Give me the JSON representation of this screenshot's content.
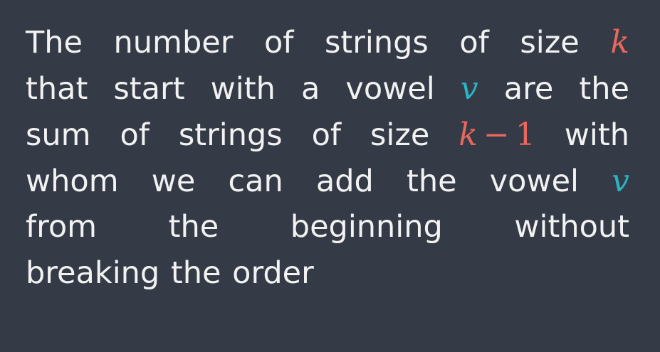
{
  "lines": [
    [
      "The",
      "number",
      "of",
      "strings",
      "of",
      "size"
    ],
    [
      "that",
      "start",
      "with",
      "a",
      "vowel"
    ],
    [
      "sum",
      "of",
      "strings",
      "of",
      "size"
    ],
    [
      "whom",
      "we",
      "can",
      "add",
      "the",
      "vowel"
    ],
    [
      "from",
      "the",
      "beginning",
      "without"
    ],
    [
      "breaking the order"
    ]
  ],
  "line2_tail": [
    "are",
    "the"
  ],
  "line3_tail": "with",
  "math": {
    "k": "k",
    "v": "v",
    "minus": "−",
    "one": "1"
  },
  "colors": {
    "background": "#343a46",
    "text": "#f2f2f2",
    "k_color": "#e8675f",
    "v_color": "#2cb3c4"
  }
}
